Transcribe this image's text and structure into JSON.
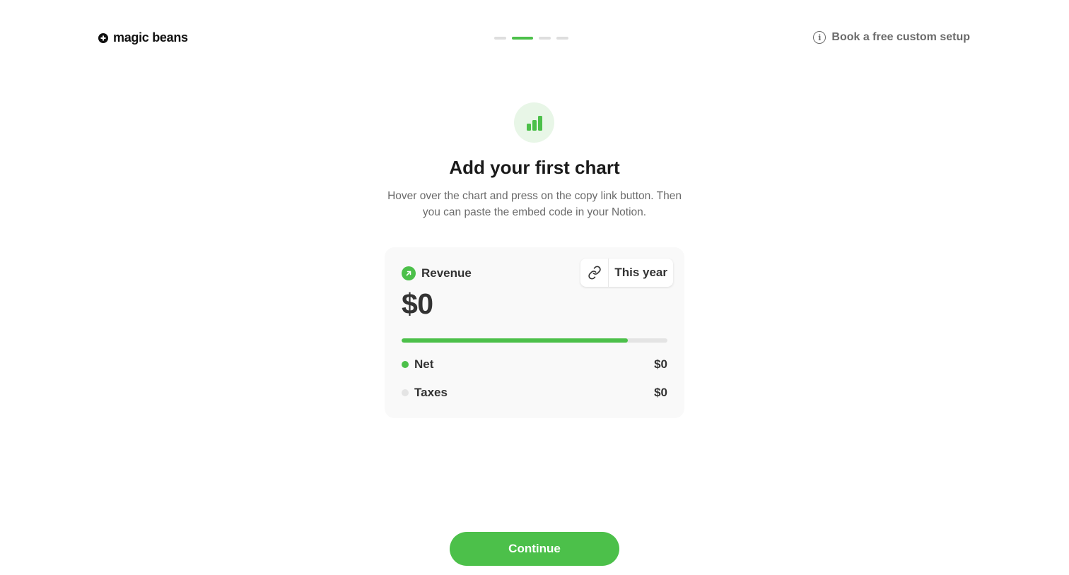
{
  "header": {
    "brand": "magic beans",
    "steps": {
      "total": 4,
      "active_index": 1
    },
    "setup_link": "Book a free custom setup"
  },
  "hero": {
    "icon": "bar-chart-icon",
    "title": "Add your first chart",
    "subtitle": "Hover over the chart and press on the copy link button. Then you can paste the embed code in your Notion."
  },
  "card": {
    "label": "Revenue",
    "label_icon": "arrow-up-right-icon",
    "amount": "$0",
    "copy_icon": "link-icon",
    "period": "This year",
    "progress": 0.85,
    "legend": [
      {
        "name": "Net",
        "value": "$0",
        "color": "#4cc04a"
      },
      {
        "name": "Taxes",
        "value": "$0",
        "color": "#e4e4e4"
      }
    ]
  },
  "actions": {
    "continue_label": "Continue"
  },
  "colors": {
    "accent": "#4cc04a",
    "accent_soft": "#e8f6e7",
    "muted_text": "#6b6b6b"
  }
}
